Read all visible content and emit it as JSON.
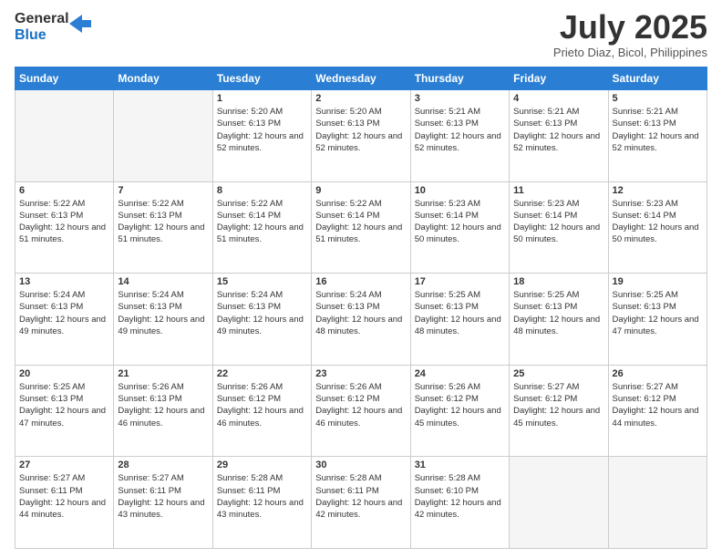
{
  "logo": {
    "general": "General",
    "blue": "Blue"
  },
  "header": {
    "month": "July 2025",
    "location": "Prieto Diaz, Bicol, Philippines"
  },
  "weekdays": [
    "Sunday",
    "Monday",
    "Tuesday",
    "Wednesday",
    "Thursday",
    "Friday",
    "Saturday"
  ],
  "weeks": [
    [
      {
        "day": "",
        "info": ""
      },
      {
        "day": "",
        "info": ""
      },
      {
        "day": "1",
        "info": "Sunrise: 5:20 AM\nSunset: 6:13 PM\nDaylight: 12 hours and 52 minutes."
      },
      {
        "day": "2",
        "info": "Sunrise: 5:20 AM\nSunset: 6:13 PM\nDaylight: 12 hours and 52 minutes."
      },
      {
        "day": "3",
        "info": "Sunrise: 5:21 AM\nSunset: 6:13 PM\nDaylight: 12 hours and 52 minutes."
      },
      {
        "day": "4",
        "info": "Sunrise: 5:21 AM\nSunset: 6:13 PM\nDaylight: 12 hours and 52 minutes."
      },
      {
        "day": "5",
        "info": "Sunrise: 5:21 AM\nSunset: 6:13 PM\nDaylight: 12 hours and 52 minutes."
      }
    ],
    [
      {
        "day": "6",
        "info": "Sunrise: 5:22 AM\nSunset: 6:13 PM\nDaylight: 12 hours and 51 minutes."
      },
      {
        "day": "7",
        "info": "Sunrise: 5:22 AM\nSunset: 6:13 PM\nDaylight: 12 hours and 51 minutes."
      },
      {
        "day": "8",
        "info": "Sunrise: 5:22 AM\nSunset: 6:14 PM\nDaylight: 12 hours and 51 minutes."
      },
      {
        "day": "9",
        "info": "Sunrise: 5:22 AM\nSunset: 6:14 PM\nDaylight: 12 hours and 51 minutes."
      },
      {
        "day": "10",
        "info": "Sunrise: 5:23 AM\nSunset: 6:14 PM\nDaylight: 12 hours and 50 minutes."
      },
      {
        "day": "11",
        "info": "Sunrise: 5:23 AM\nSunset: 6:14 PM\nDaylight: 12 hours and 50 minutes."
      },
      {
        "day": "12",
        "info": "Sunrise: 5:23 AM\nSunset: 6:14 PM\nDaylight: 12 hours and 50 minutes."
      }
    ],
    [
      {
        "day": "13",
        "info": "Sunrise: 5:24 AM\nSunset: 6:13 PM\nDaylight: 12 hours and 49 minutes."
      },
      {
        "day": "14",
        "info": "Sunrise: 5:24 AM\nSunset: 6:13 PM\nDaylight: 12 hours and 49 minutes."
      },
      {
        "day": "15",
        "info": "Sunrise: 5:24 AM\nSunset: 6:13 PM\nDaylight: 12 hours and 49 minutes."
      },
      {
        "day": "16",
        "info": "Sunrise: 5:24 AM\nSunset: 6:13 PM\nDaylight: 12 hours and 48 minutes."
      },
      {
        "day": "17",
        "info": "Sunrise: 5:25 AM\nSunset: 6:13 PM\nDaylight: 12 hours and 48 minutes."
      },
      {
        "day": "18",
        "info": "Sunrise: 5:25 AM\nSunset: 6:13 PM\nDaylight: 12 hours and 48 minutes."
      },
      {
        "day": "19",
        "info": "Sunrise: 5:25 AM\nSunset: 6:13 PM\nDaylight: 12 hours and 47 minutes."
      }
    ],
    [
      {
        "day": "20",
        "info": "Sunrise: 5:25 AM\nSunset: 6:13 PM\nDaylight: 12 hours and 47 minutes."
      },
      {
        "day": "21",
        "info": "Sunrise: 5:26 AM\nSunset: 6:13 PM\nDaylight: 12 hours and 46 minutes."
      },
      {
        "day": "22",
        "info": "Sunrise: 5:26 AM\nSunset: 6:12 PM\nDaylight: 12 hours and 46 minutes."
      },
      {
        "day": "23",
        "info": "Sunrise: 5:26 AM\nSunset: 6:12 PM\nDaylight: 12 hours and 46 minutes."
      },
      {
        "day": "24",
        "info": "Sunrise: 5:26 AM\nSunset: 6:12 PM\nDaylight: 12 hours and 45 minutes."
      },
      {
        "day": "25",
        "info": "Sunrise: 5:27 AM\nSunset: 6:12 PM\nDaylight: 12 hours and 45 minutes."
      },
      {
        "day": "26",
        "info": "Sunrise: 5:27 AM\nSunset: 6:12 PM\nDaylight: 12 hours and 44 minutes."
      }
    ],
    [
      {
        "day": "27",
        "info": "Sunrise: 5:27 AM\nSunset: 6:11 PM\nDaylight: 12 hours and 44 minutes."
      },
      {
        "day": "28",
        "info": "Sunrise: 5:27 AM\nSunset: 6:11 PM\nDaylight: 12 hours and 43 minutes."
      },
      {
        "day": "29",
        "info": "Sunrise: 5:28 AM\nSunset: 6:11 PM\nDaylight: 12 hours and 43 minutes."
      },
      {
        "day": "30",
        "info": "Sunrise: 5:28 AM\nSunset: 6:11 PM\nDaylight: 12 hours and 42 minutes."
      },
      {
        "day": "31",
        "info": "Sunrise: 5:28 AM\nSunset: 6:10 PM\nDaylight: 12 hours and 42 minutes."
      },
      {
        "day": "",
        "info": ""
      },
      {
        "day": "",
        "info": ""
      }
    ]
  ]
}
